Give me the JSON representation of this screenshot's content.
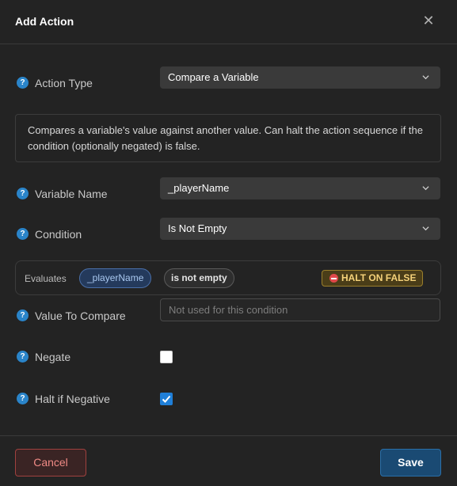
{
  "dialog": {
    "title": "Add Action",
    "close_glyph": "✕"
  },
  "fields": {
    "action_type": {
      "label": "Action Type",
      "value": "Compare a Variable"
    },
    "description": "Compares a variable's value against another value. Can halt the action sequence if the condition (optionally negated) is false.",
    "variable_name": {
      "label": "Variable Name",
      "value": "_playerName"
    },
    "condition": {
      "label": "Condition",
      "value": "Is Not Empty"
    },
    "value_to_compare": {
      "label": "Value To Compare",
      "value": "",
      "placeholder": "Not used for this condition"
    },
    "negate": {
      "label": "Negate",
      "checked": false
    },
    "halt_if_negative": {
      "label": "Halt if Negative",
      "checked": true
    }
  },
  "evaluation": {
    "label": "Evaluates",
    "variable": "_playerName",
    "condition": "is not empty",
    "halt_badge": "HALT ON FALSE"
  },
  "help_glyph": "?",
  "footer": {
    "cancel_label": "Cancel",
    "save_label": "Save"
  },
  "colors": {
    "background": "#232323",
    "help_icon": "#2a84c9",
    "checkbox_on": "#1f7fd8",
    "cancel": "#f08a85",
    "save": "#1a4a73",
    "halt_badge": "#f5d27a",
    "variable_pill": "#a9c8f0"
  },
  "icons": {
    "help": "question-circle-icon",
    "dropdown": "chevron-down-icon",
    "close": "close-icon",
    "halt": "stop-icon",
    "checkmark": "check-icon"
  }
}
